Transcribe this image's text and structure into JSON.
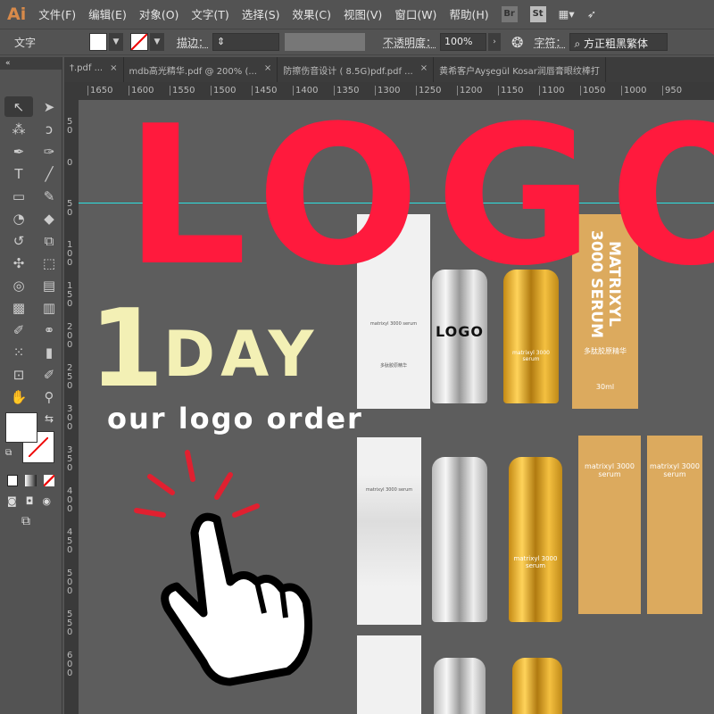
{
  "app": {
    "logo": "Ai"
  },
  "menu": [
    "文件(F)",
    "编辑(E)",
    "对象(O)",
    "文字(T)",
    "选择(S)",
    "效果(C)",
    "视图(V)",
    "窗口(W)",
    "帮助(H)"
  ],
  "app_buttons": [
    "Br",
    "St"
  ],
  "control": {
    "type_label": "文字",
    "stroke_label": "描边：",
    "opacity_label": "不透明度：",
    "opacity_value": "100%",
    "char_label": "字符：",
    "font_value": "方正粗黑繁体"
  },
  "tabs": [
    {
      "label": "†.pdf ...",
      "close": "×"
    },
    {
      "label": "mdb高光精华.pdf @ 200% (...",
      "close": "×"
    },
    {
      "label": "防擦伤音设计 ( 8.5G)pdf.pdf ...",
      "close": "×"
    },
    {
      "label": "黄希客户Ayşegül Kosar润唇膏眼纹棒打",
      "close": ""
    }
  ],
  "hruler": [
    "1650",
    "1600",
    "1550",
    "1500",
    "1450",
    "1400",
    "1350",
    "1300",
    "1250",
    "1200",
    "1150",
    "1100",
    "1050",
    "1000",
    "950"
  ],
  "vruler": [
    "50",
    "0",
    "50",
    "100",
    "150",
    "200",
    "250",
    "300",
    "350",
    "400",
    "450",
    "500",
    "550",
    "600"
  ],
  "canvas": {
    "logo_text": "LOGO",
    "one": "1",
    "day": "DAY",
    "order": "our logo order",
    "bottle_logo": "LOGO",
    "box_vertical": "MATRIXYL 3000 SERUM",
    "box_serum": "matrixyl 3000 serum",
    "box_cn": "多肽胶原精华",
    "box_ml": "30ml",
    "box_small": "matrixyl 3000 serum"
  },
  "colors": {
    "accent_red": "#ff1a3d",
    "day_yellow": "#f3f0b5",
    "guide": "#2de0e0"
  }
}
